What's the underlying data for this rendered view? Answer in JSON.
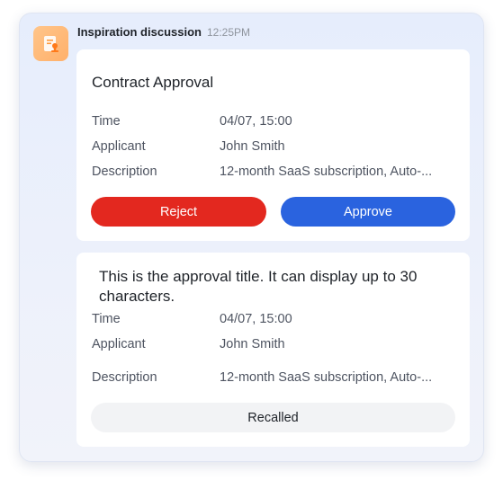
{
  "message": {
    "sender": "Inspiration discussion",
    "time": "12:25PM",
    "avatar_icon": "approval-stamp-icon",
    "avatar_color": "#ffb26e"
  },
  "card1": {
    "title": "Contract Approval",
    "fields": [
      {
        "label": "Time",
        "value": "04/07, 15:00"
      },
      {
        "label": "Applicant",
        "value": "John Smith"
      },
      {
        "label": "Description",
        "value": "12-month SaaS subscription, Auto-..."
      }
    ],
    "reject_label": "Reject",
    "approve_label": "Approve",
    "reject_color": "#e3281f",
    "approve_color": "#2a63df"
  },
  "card2": {
    "title": "This is the approval title. It can display up to 30 characters.",
    "fields": [
      {
        "label": "Time",
        "value": "04/07, 15:00"
      },
      {
        "label": "Applicant",
        "value": "John Smith"
      },
      {
        "label": "Description",
        "value": "12-month SaaS subscription, Auto-..."
      }
    ],
    "status_label": "Recalled"
  }
}
